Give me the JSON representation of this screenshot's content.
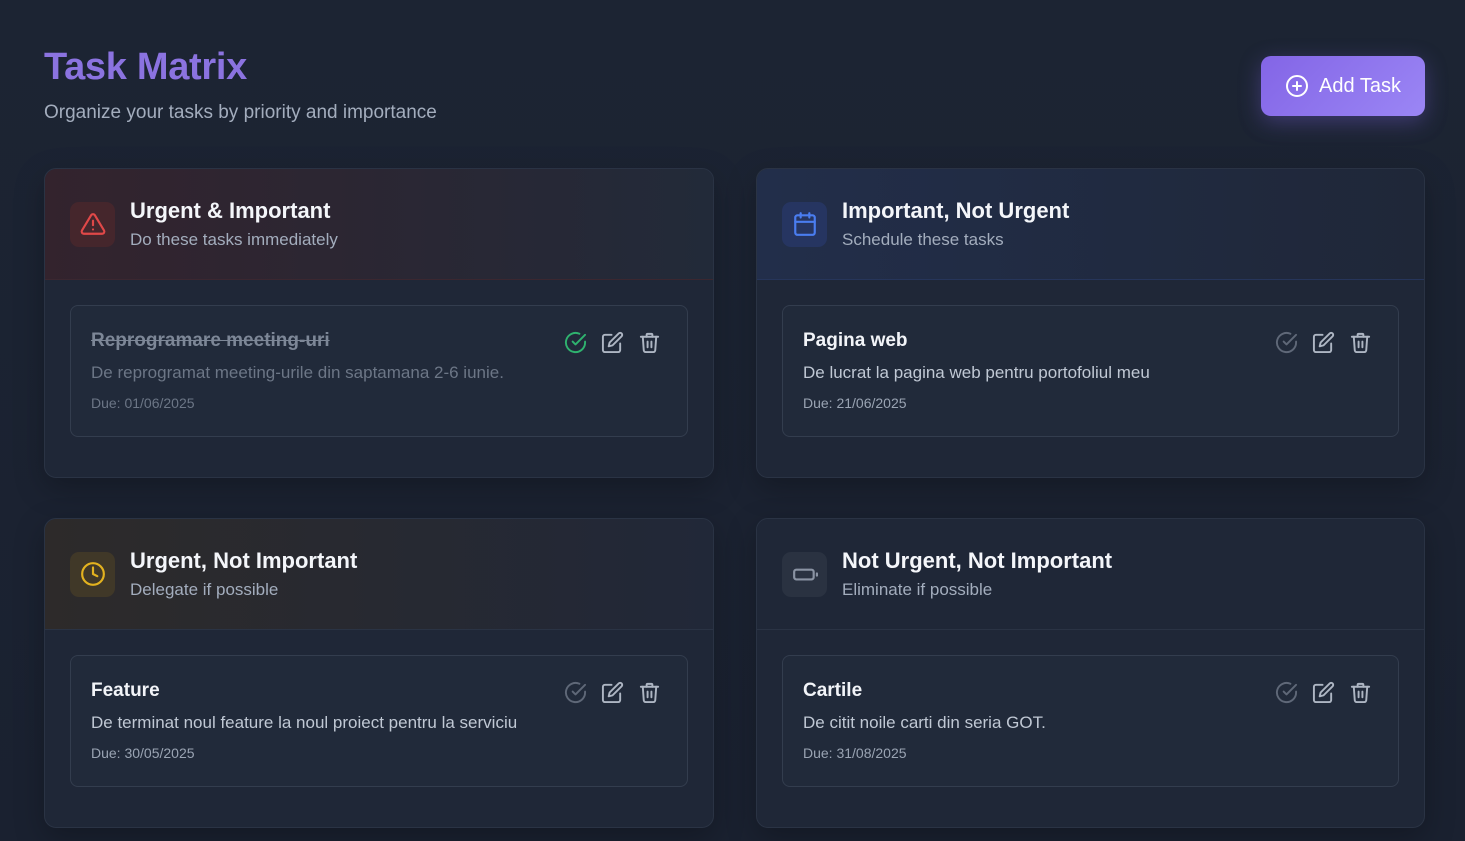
{
  "header": {
    "title": "Task Matrix",
    "subtitle": "Organize your tasks by priority and importance",
    "add_button_label": "Add Task",
    "add_button_icon": "plus-circle-icon"
  },
  "colors": {
    "accent": "#8b73e0",
    "urgent_important": "#e04848",
    "important_not_urgent": "#4a7df0",
    "urgent_not_important": "#e3b21f",
    "not_urgent_not_important": "#8a93a3",
    "done_check": "#2fb36f"
  },
  "quadrants": [
    {
      "title": "Urgent & Important",
      "subtitle": "Do these tasks immediately",
      "icon": "alert-triangle-icon",
      "tasks": [
        {
          "title": "Reprogramare meeting-uri",
          "description": "De reprogramat meeting-urile din saptamana 2-6 iunie.",
          "due": "Due: 01/06/2025",
          "completed": true
        }
      ]
    },
    {
      "title": "Important, Not Urgent",
      "subtitle": "Schedule these tasks",
      "icon": "calendar-icon",
      "tasks": [
        {
          "title": "Pagina web",
          "description": "De lucrat la pagina web pentru portofoliul meu",
          "due": "Due: 21/06/2025",
          "completed": false
        }
      ]
    },
    {
      "title": "Urgent, Not Important",
      "subtitle": "Delegate if possible",
      "icon": "clock-icon",
      "tasks": [
        {
          "title": "Feature",
          "description": "De terminat noul feature la noul proiect pentru la serviciu",
          "due": "Due: 30/05/2025",
          "completed": false
        }
      ]
    },
    {
      "title": "Not Urgent, Not Important",
      "subtitle": "Eliminate if possible",
      "icon": "battery-icon",
      "tasks": [
        {
          "title": "Cartile",
          "description": "De citit noile carti din seria GOT.",
          "due": "Due: 31/08/2025",
          "completed": false
        }
      ]
    }
  ]
}
